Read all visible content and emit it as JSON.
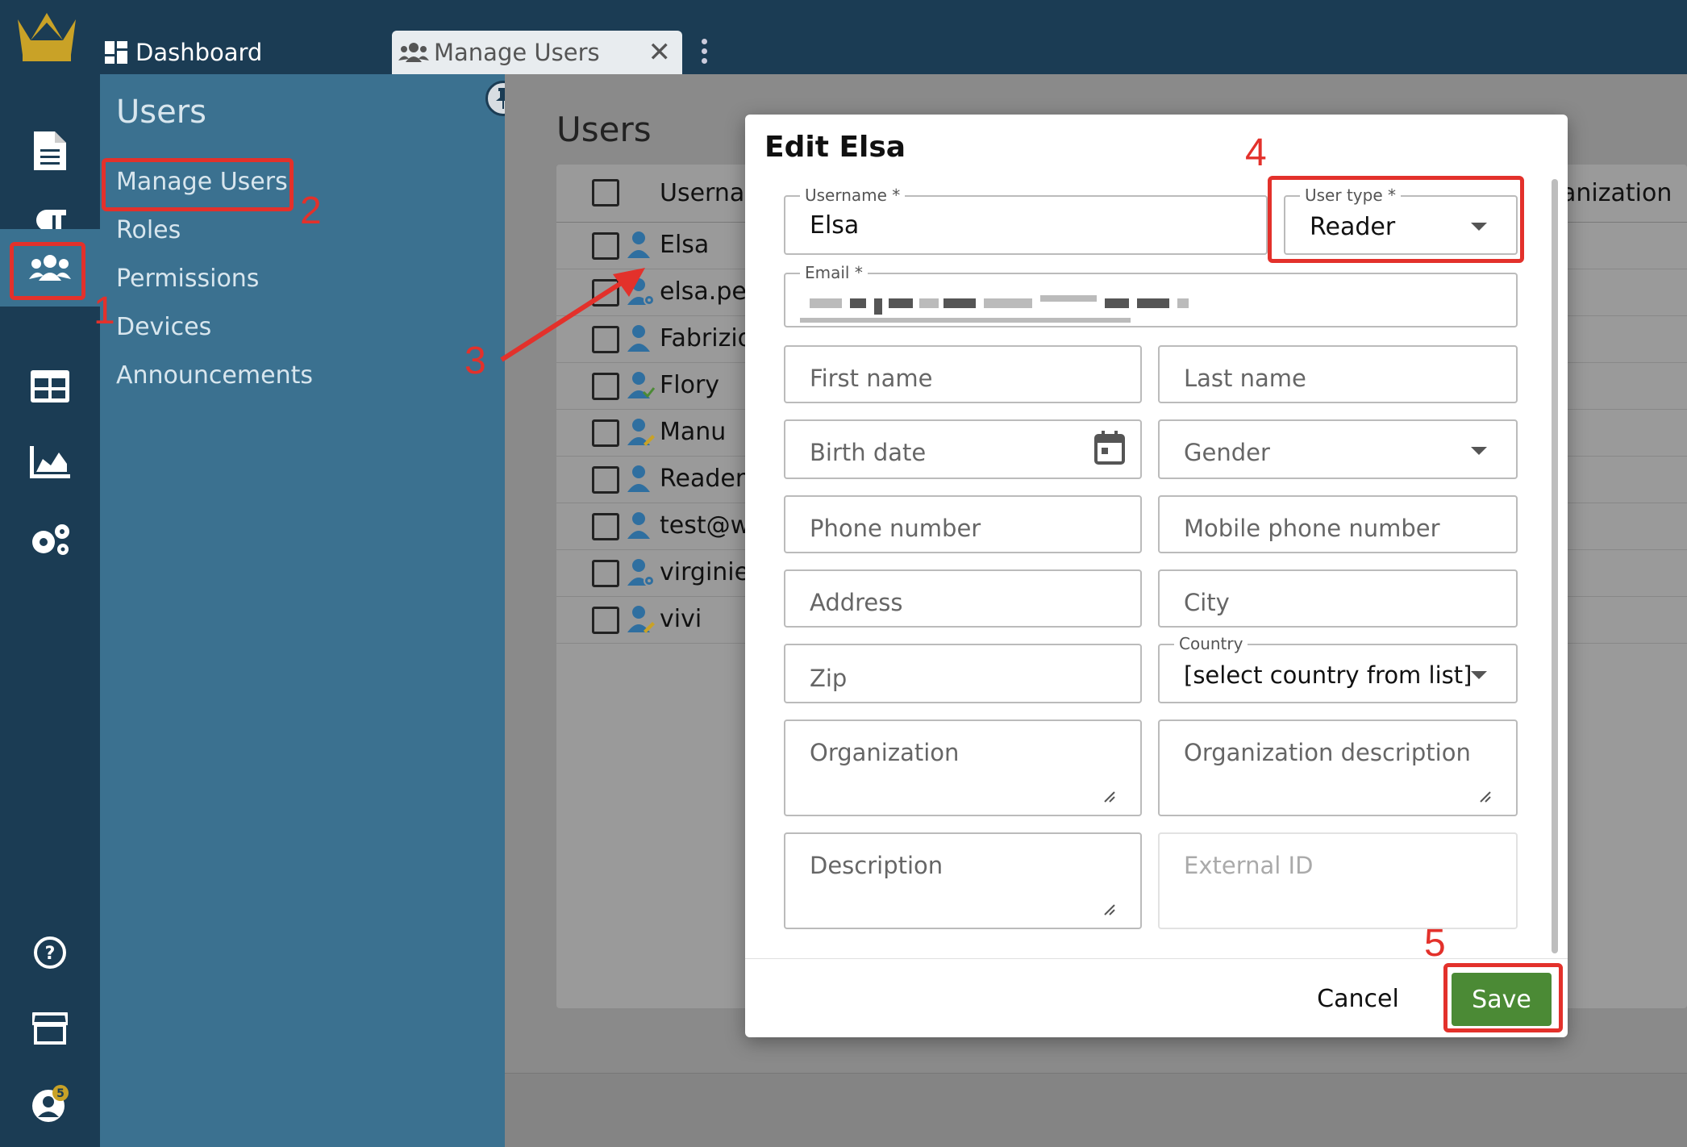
{
  "top_tabs": {
    "dashboard": "Dashboard",
    "manage_users": "Manage Users",
    "close_glyph": "✕"
  },
  "submenu": {
    "title": "Users",
    "items": [
      "Manage Users",
      "Roles",
      "Permissions",
      "Devices",
      "Announcements"
    ]
  },
  "rail": {
    "notification_count": "5"
  },
  "main": {
    "title": "Users",
    "table": {
      "header_username": "Usernan",
      "header_org": "anization",
      "rows": [
        "Elsa",
        "elsa.per",
        "Fabrizio",
        "Flory",
        "Manu",
        "ReaderT",
        "test@we",
        "virginie.l",
        "vivi"
      ]
    }
  },
  "modal": {
    "title": "Edit Elsa",
    "username_label": "Username *",
    "username_value": "Elsa",
    "usertype_label": "User type *",
    "usertype_value": "Reader",
    "email_label": "Email *",
    "first_name": "First name",
    "last_name": "Last name",
    "birth_date": "Birth date",
    "gender": "Gender",
    "phone": "Phone number",
    "mobile": "Mobile phone number",
    "address": "Address",
    "city": "City",
    "zip": "Zip",
    "country_label": "Country",
    "country_value": "[select country from list]",
    "organization": "Organization",
    "organization_description": "Organization description",
    "description": "Description",
    "external_id": "External ID",
    "cancel": "Cancel",
    "save": "Save"
  },
  "annotations": [
    "1",
    "2",
    "3",
    "4",
    "5"
  ],
  "colors": {
    "topbar": "#1b3c54",
    "submenu": "#3b7190",
    "annotation_red": "#e3312b",
    "save_green": "#4b8a35"
  }
}
